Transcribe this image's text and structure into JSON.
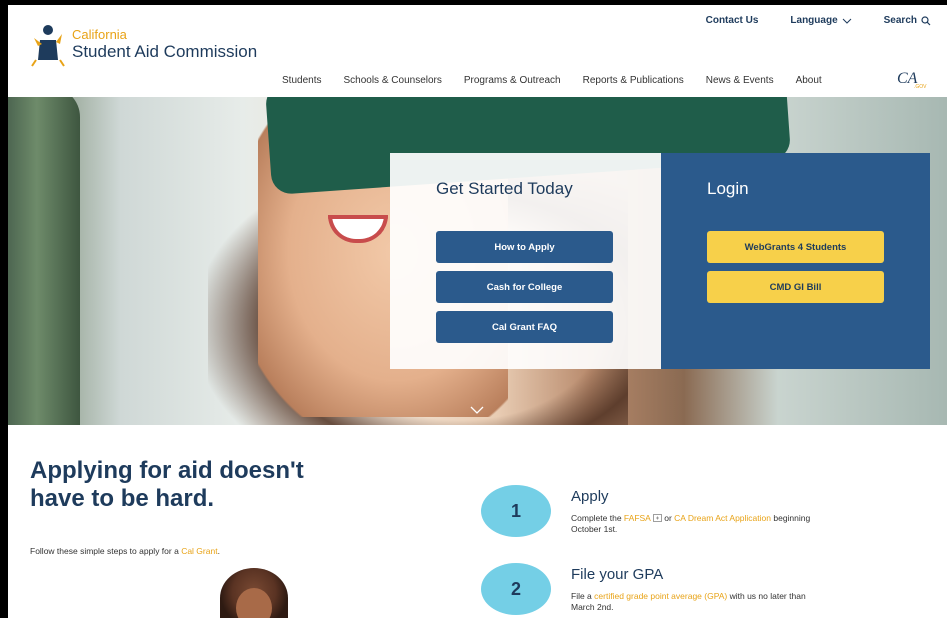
{
  "header": {
    "logo_small": "California",
    "logo_big": "Student Aid Commission",
    "utility": {
      "contact": "Contact Us",
      "language": "Language",
      "search": "Search"
    },
    "nav": [
      "Students",
      "Schools & Counselors",
      "Programs & Outreach",
      "Reports & Publications",
      "News & Events",
      "About"
    ],
    "ca_gov": "CA.GOV"
  },
  "hero": {
    "get_started_title": "Get Started Today",
    "buttons": [
      "How to Apply",
      "Cash for College",
      "Cal Grant FAQ"
    ],
    "login_title": "Login",
    "login_buttons": [
      "WebGrants 4 Students",
      "CMD GI Bill"
    ]
  },
  "intro": {
    "headline": "Applying for aid doesn't have to be hard.",
    "sub_prefix": "Follow these simple steps to apply for a ",
    "sub_link": "Cal Grant",
    "sub_suffix": "."
  },
  "steps": [
    {
      "number": "1",
      "title": "Apply",
      "desc_a": "Complete the ",
      "link_a": "FAFSA",
      "desc_b": " or ",
      "link_b": "CA Dream Act Application",
      "desc_c": " beginning October 1st."
    },
    {
      "number": "2",
      "title": "File your GPA",
      "desc_a": "File a ",
      "link_a": "certified grade point average (GPA)",
      "desc_b": " with us no later than March 2nd."
    }
  ],
  "colors": {
    "navy": "#1e3b5c",
    "button_blue": "#2b5a8c",
    "button_yellow": "#f7d04a",
    "accent_orange": "#e8a317",
    "step_circle": "#74cfe6"
  }
}
